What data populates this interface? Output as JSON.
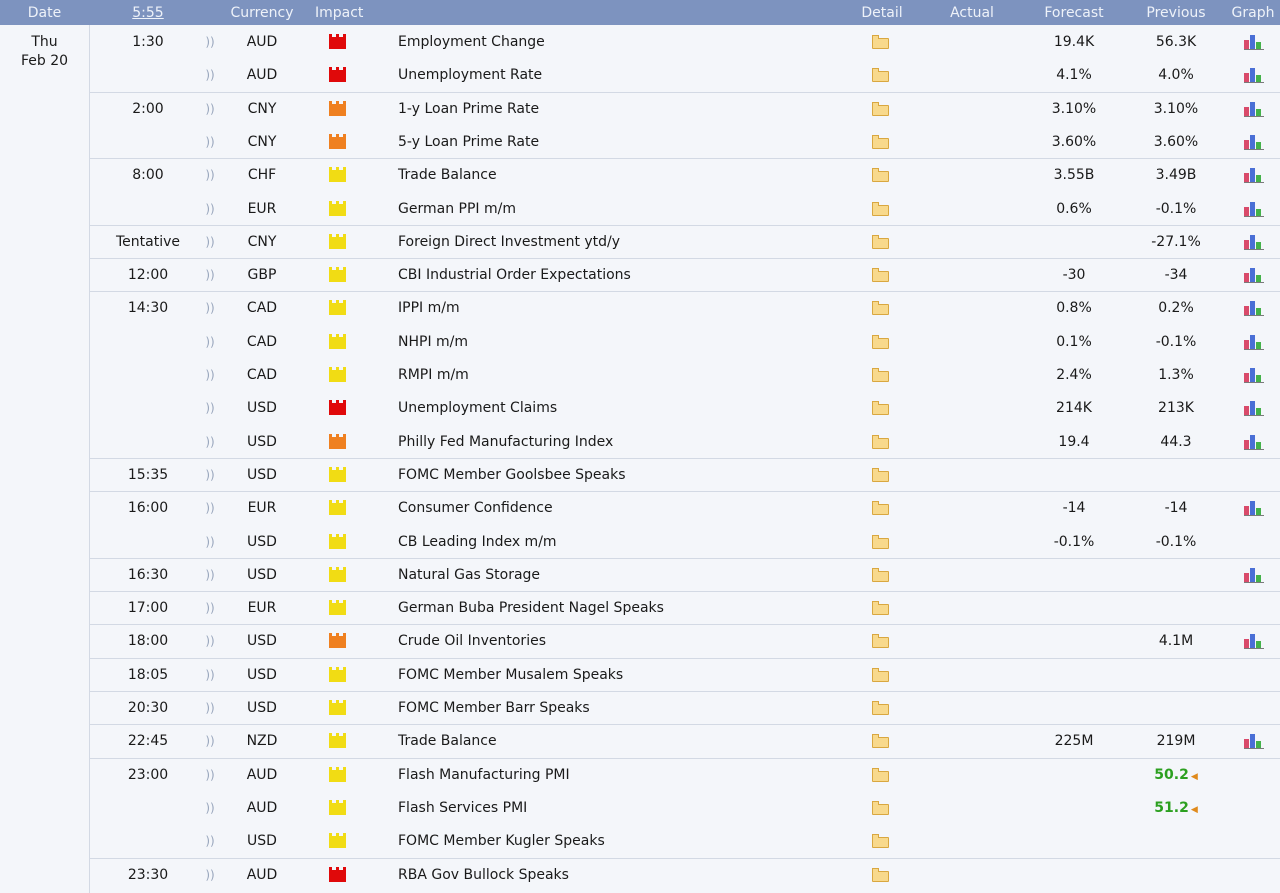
{
  "header": {
    "date": "Date",
    "time": "5:55",
    "currency": "Currency",
    "impact": "Impact",
    "detail": "Detail",
    "actual": "Actual",
    "forecast": "Forecast",
    "previous": "Previous",
    "graph": "Graph"
  },
  "date": {
    "day": "Thu",
    "date": "Feb 20"
  },
  "colors": {
    "header_bg": "#7d93bf",
    "high": "#e0090a",
    "medium": "#ef8020",
    "low": "#f1dc14",
    "better": "#2ca020"
  },
  "events": [
    {
      "time": "1:30",
      "currency": "AUD",
      "impact": "high",
      "event": "Employment Change",
      "actual": "",
      "forecast": "19.4K",
      "previous": "56.3K",
      "graph": true
    },
    {
      "time": "",
      "currency": "AUD",
      "impact": "high",
      "event": "Unemployment Rate",
      "actual": "",
      "forecast": "4.1%",
      "previous": "4.0%",
      "graph": true
    },
    {
      "time": "2:00",
      "currency": "CNY",
      "impact": "medium",
      "event": "1-y Loan Prime Rate",
      "actual": "",
      "forecast": "3.10%",
      "previous": "3.10%",
      "graph": true
    },
    {
      "time": "",
      "currency": "CNY",
      "impact": "medium",
      "event": "5-y Loan Prime Rate",
      "actual": "",
      "forecast": "3.60%",
      "previous": "3.60%",
      "graph": true
    },
    {
      "time": "8:00",
      "currency": "CHF",
      "impact": "low",
      "event": "Trade Balance",
      "actual": "",
      "forecast": "3.55B",
      "previous": "3.49B",
      "graph": true
    },
    {
      "time": "",
      "currency": "EUR",
      "impact": "low",
      "event": "German PPI m/m",
      "actual": "",
      "forecast": "0.6%",
      "previous": "-0.1%",
      "graph": true
    },
    {
      "time": "Tentative",
      "currency": "CNY",
      "impact": "low",
      "event": "Foreign Direct Investment ytd/y",
      "actual": "",
      "forecast": "",
      "previous": "-27.1%",
      "graph": true
    },
    {
      "time": "12:00",
      "currency": "GBP",
      "impact": "low",
      "event": "CBI Industrial Order Expectations",
      "actual": "",
      "forecast": "-30",
      "previous": "-34",
      "graph": true
    },
    {
      "time": "14:30",
      "currency": "CAD",
      "impact": "low",
      "event": "IPPI m/m",
      "actual": "",
      "forecast": "0.8%",
      "previous": "0.2%",
      "graph": true
    },
    {
      "time": "",
      "currency": "CAD",
      "impact": "low",
      "event": "NHPI m/m",
      "actual": "",
      "forecast": "0.1%",
      "previous": "-0.1%",
      "graph": true
    },
    {
      "time": "",
      "currency": "CAD",
      "impact": "low",
      "event": "RMPI m/m",
      "actual": "",
      "forecast": "2.4%",
      "previous": "1.3%",
      "graph": true
    },
    {
      "time": "",
      "currency": "USD",
      "impact": "high",
      "event": "Unemployment Claims",
      "actual": "",
      "forecast": "214K",
      "previous": "213K",
      "graph": true
    },
    {
      "time": "",
      "currency": "USD",
      "impact": "medium",
      "event": "Philly Fed Manufacturing Index",
      "actual": "",
      "forecast": "19.4",
      "previous": "44.3",
      "graph": true
    },
    {
      "time": "15:35",
      "currency": "USD",
      "impact": "low",
      "event": "FOMC Member Goolsbee Speaks",
      "actual": "",
      "forecast": "",
      "previous": "",
      "graph": false
    },
    {
      "time": "16:00",
      "currency": "EUR",
      "impact": "low",
      "event": "Consumer Confidence",
      "actual": "",
      "forecast": "-14",
      "previous": "-14",
      "graph": true
    },
    {
      "time": "",
      "currency": "USD",
      "impact": "low",
      "event": "CB Leading Index m/m",
      "actual": "",
      "forecast": "-0.1%",
      "previous": "-0.1%",
      "graph": false
    },
    {
      "time": "16:30",
      "currency": "USD",
      "impact": "low",
      "event": "Natural Gas Storage",
      "actual": "",
      "forecast": "",
      "previous": "",
      "graph": true
    },
    {
      "time": "17:00",
      "currency": "EUR",
      "impact": "low",
      "event": "German Buba President Nagel Speaks",
      "actual": "",
      "forecast": "",
      "previous": "",
      "graph": false
    },
    {
      "time": "18:00",
      "currency": "USD",
      "impact": "medium",
      "event": "Crude Oil Inventories",
      "actual": "",
      "forecast": "",
      "previous": "4.1M",
      "graph": true
    },
    {
      "time": "18:05",
      "currency": "USD",
      "impact": "low",
      "event": "FOMC Member Musalem Speaks",
      "actual": "",
      "forecast": "",
      "previous": "",
      "graph": false
    },
    {
      "time": "20:30",
      "currency": "USD",
      "impact": "low",
      "event": "FOMC Member Barr Speaks",
      "actual": "",
      "forecast": "",
      "previous": "",
      "graph": false
    },
    {
      "time": "22:45",
      "currency": "NZD",
      "impact": "low",
      "event": "Trade Balance",
      "actual": "",
      "forecast": "225M",
      "previous": "219M",
      "graph": true
    },
    {
      "time": "23:00",
      "currency": "AUD",
      "impact": "low",
      "event": "Flash Manufacturing PMI",
      "actual": "",
      "forecast": "",
      "previous": "50.2",
      "previous_better": true,
      "revised": true,
      "graph": false
    },
    {
      "time": "",
      "currency": "AUD",
      "impact": "low",
      "event": "Flash Services PMI",
      "actual": "",
      "forecast": "",
      "previous": "51.2",
      "previous_better": true,
      "revised": true,
      "graph": false
    },
    {
      "time": "",
      "currency": "USD",
      "impact": "low",
      "event": "FOMC Member Kugler Speaks",
      "actual": "",
      "forecast": "",
      "previous": "",
      "graph": false
    },
    {
      "time": "23:30",
      "currency": "AUD",
      "impact": "high",
      "event": "RBA Gov Bullock Speaks",
      "actual": "",
      "forecast": "",
      "previous": "",
      "graph": false
    }
  ]
}
